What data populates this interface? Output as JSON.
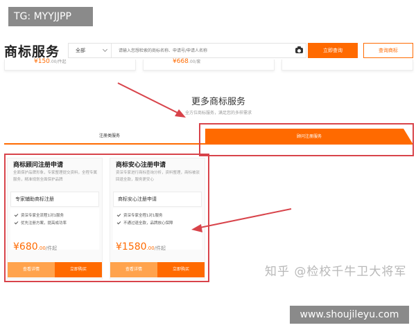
{
  "watermark_top": "TG: MYYJJPP",
  "header": {
    "brand_title": "商标服务",
    "search_scope": "全部",
    "search_placeholder": "请输入您想检索的商标名称、申请号/申请人名称",
    "camera_icon": "camera-icon",
    "query_button": "立即查询",
    "lookup_button": "查询商标"
  },
  "top_prices": [
    {
      "main": "¥150",
      "cents": ".00",
      "unit": "/件起"
    },
    {
      "main": "¥668",
      "cents": ".00",
      "unit": "/套"
    }
  ],
  "section": {
    "title": "更多商标服务",
    "subtitle": "全方位商标服务，满足您的多样需求"
  },
  "tabs": {
    "registration": "注册类服务",
    "consultant": "顾问注册服务"
  },
  "cards": [
    {
      "title": "商标顾问注册申请",
      "desc": "全面保护品牌形象，专家整理提交资料，全程专属服务，精准规划全面保护品牌",
      "sub": "专家辅助商标注册",
      "features": [
        "资深专家全流程1对1服务",
        "优先注册方案，提高成功率"
      ],
      "price": "¥680",
      "cents": ".00",
      "unit": "/件起",
      "detail_button": "查看详情",
      "buy_button": "立即购买"
    },
    {
      "title": "商标安心注册申请",
      "desc": "资深专家进行商标查询分析，资料整理，商标被驳回退全款，服务更安心",
      "sub": "商标安心注册申请",
      "features": [
        "资深专家全程1对1服务",
        "不通过退全款，品牌放心保障"
      ],
      "price": "¥1580",
      "cents": ".00",
      "unit": "/件起",
      "detail_button": "查看详情",
      "buy_button": "立即购买"
    }
  ],
  "zhihu_watermark": "知乎 @检校千牛卫大将军",
  "site_badge": "www.shoujileyu.com",
  "colors": {
    "accent": "#ff6a00",
    "annotation": "#d8434a"
  }
}
